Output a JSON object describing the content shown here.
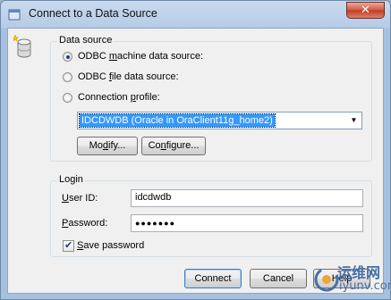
{
  "window": {
    "title": "Connect to a Data Source",
    "close_glyph": "✕",
    "icon": "database-icon"
  },
  "data_source": {
    "group_label": "Data source",
    "options": [
      {
        "pre": "ODBC ",
        "key": "m",
        "post": "achine data source:",
        "checked": true
      },
      {
        "pre": "ODBC ",
        "key": "f",
        "post": "ile data source:",
        "checked": false
      },
      {
        "pre": "Connection ",
        "key": "p",
        "post": "rofile:",
        "checked": false
      }
    ],
    "profile_value": "IDCDWDB (Oracle in OraClient11g_home2)",
    "buttons": {
      "modify": {
        "pre": "Mo",
        "key": "d",
        "post": "ify..."
      },
      "configure": {
        "pre": "Co",
        "key": "n",
        "post": "figure..."
      }
    }
  },
  "login": {
    "group_label": "Login",
    "user_id": {
      "key": "U",
      "rest": "ser ID:",
      "value": "idcdwdb"
    },
    "password": {
      "key": "P",
      "rest": "assword:",
      "masked_value": "●●●●●●●"
    },
    "save_password": {
      "key": "S",
      "rest": "ave password",
      "checked": true
    }
  },
  "footer": {
    "connect": "Connect",
    "cancel": "Cancel",
    "help": "Help"
  },
  "watermark": {
    "line1": "运维网",
    "line2": "iyunv.com"
  }
}
